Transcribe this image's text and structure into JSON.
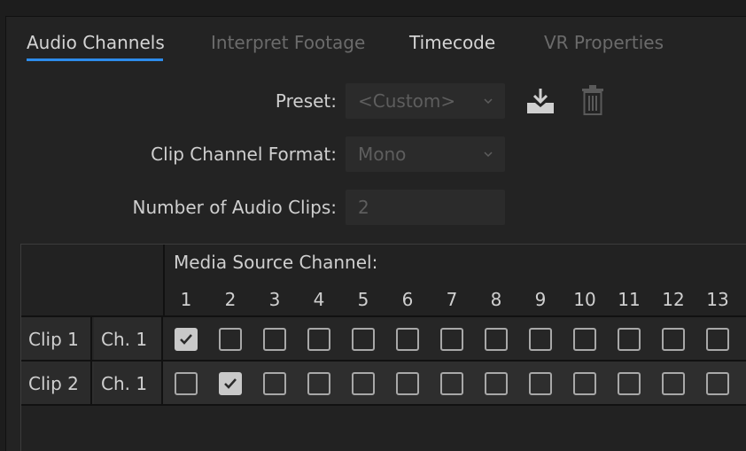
{
  "tabs": [
    {
      "label": "Audio Channels"
    },
    {
      "label": "Interpret Footage"
    },
    {
      "label": "Timecode"
    },
    {
      "label": "VR Properties"
    }
  ],
  "form": {
    "preset_label": "Preset:",
    "preset_value": "<Custom>",
    "format_label": "Clip Channel Format:",
    "format_value": "Mono",
    "count_label": "Number of Audio Clips:",
    "count_value": "2"
  },
  "icons": [
    "download-preset-icon",
    "trash-icon",
    "chevron-down-icon",
    "checkmark-icon"
  ],
  "table": {
    "header": "Media Source Channel:",
    "channels": [
      "1",
      "2",
      "3",
      "4",
      "5",
      "6",
      "7",
      "8",
      "9",
      "10",
      "11",
      "12",
      "13"
    ],
    "rows": [
      {
        "clip": "Clip 1",
        "channel": "Ch. 1",
        "checked": [
          true,
          false,
          false,
          false,
          false,
          false,
          false,
          false,
          false,
          false,
          false,
          false,
          false
        ]
      },
      {
        "clip": "Clip 2",
        "channel": "Ch. 1",
        "checked": [
          false,
          true,
          false,
          false,
          false,
          false,
          false,
          false,
          false,
          false,
          false,
          false,
          false
        ]
      }
    ]
  },
  "colors": {
    "accent": "#2d8ceb",
    "background": "#232323"
  }
}
